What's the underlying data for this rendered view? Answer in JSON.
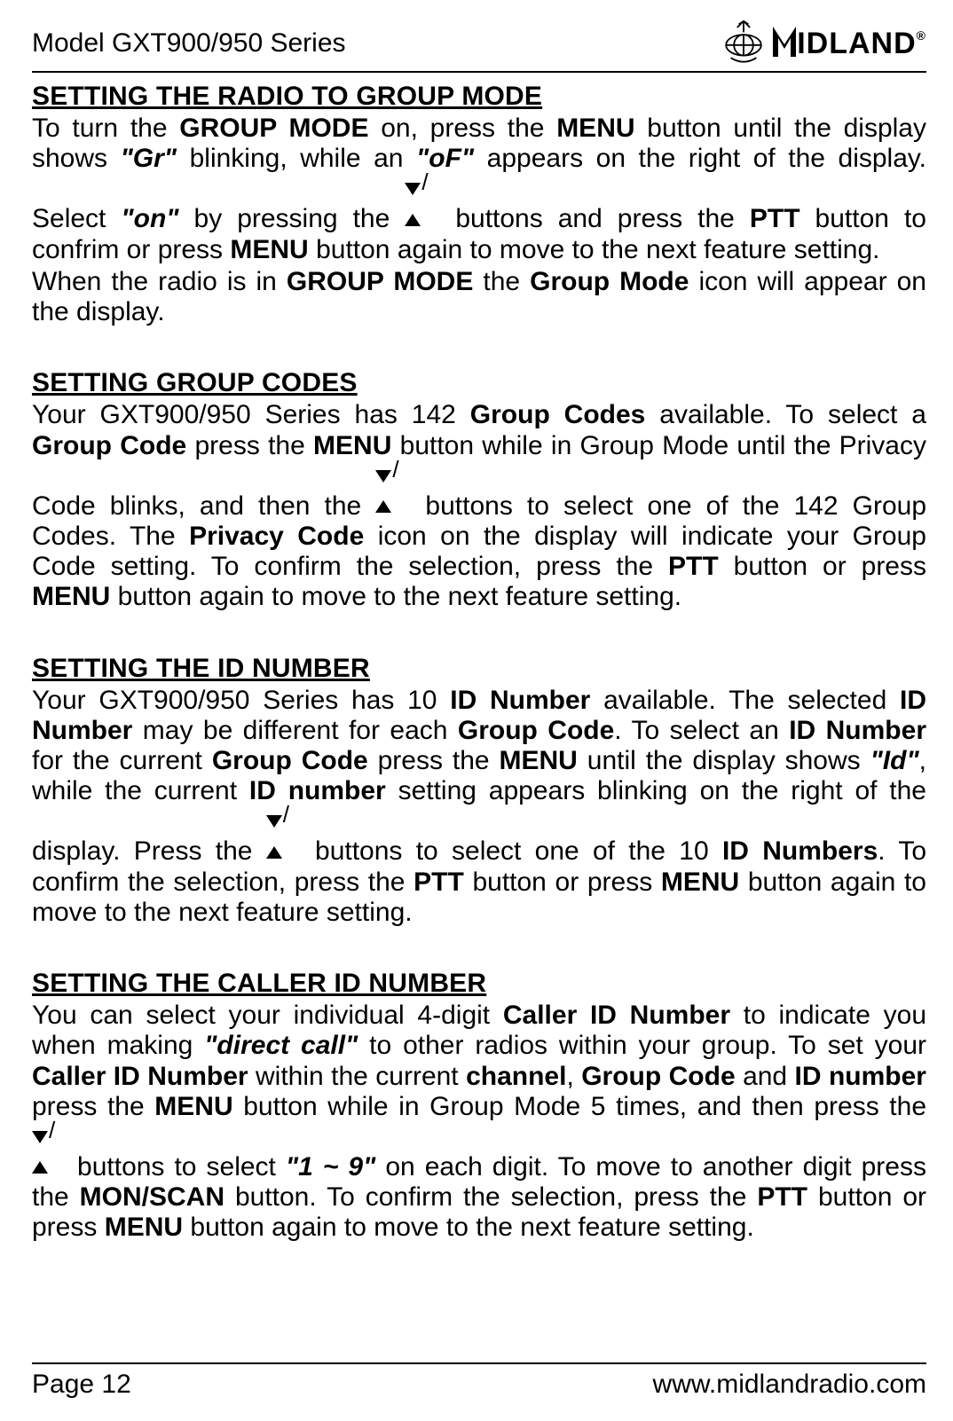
{
  "chart_data": null,
  "header": {
    "model": "Model GXT900/950 Series",
    "brand_letter": "M",
    "brand_rest": "IDLAND",
    "reg": "®"
  },
  "sections": {
    "s1": {
      "heading": "SETTING THE RADIO TO GROUP MODE",
      "p1a": "To turn the ",
      "p1b": "GROUP MODE",
      "p1c": " on, press the ",
      "p1d": "MENU",
      "p1e": " button until the display shows ",
      "p1f": "\"Gr\"",
      "p1g": " blinking, while an ",
      "p1h": "\"oF\"",
      "p1i": " appears on the right of the display. Select ",
      "p1j": "\"on\"",
      "p1k": " by pressing the ",
      "p1l": " buttons and press the ",
      "p1m": "PTT",
      "p1n": " button to confrim or press ",
      "p1o": "MENU",
      "p1p": " button again to move to the next feature setting.",
      "p2a": "When the radio is in ",
      "p2b": "GROUP MODE",
      "p2c": " the ",
      "p2d": "Group Mode",
      "p2e": " icon will appear on the display."
    },
    "s2": {
      "heading": "SETTING GROUP CODES",
      "p1a": "Your GXT900/950 Series has 142 ",
      "p1b": "Group Codes",
      "p1c": " available. To select a ",
      "p1d": "Group Code",
      "p1e": " press the ",
      "p1f": "MENU",
      "p1g": " button while in Group Mode until the Privacy Code blinks, and then the ",
      "p1h": " buttons to select one of the 142 Group Codes. The ",
      "p1i": "Privacy Code",
      "p1j": " icon on the display will indicate your Group Code setting. To confirm the selection, press the ",
      "p1k": "PTT",
      "p1l": " button or press ",
      "p1m": "MENU",
      "p1n": " button again to move to the next feature setting."
    },
    "s3": {
      "heading": "SETTING THE ID NUMBER",
      "p1a": "Your GXT900/950 Series has 10 ",
      "p1b": "ID Number",
      "p1c": " available. The selected ",
      "p1d": "ID Number",
      "p1e": " may be different for each ",
      "p1f": "Group Code",
      "p1g": ". To select an ",
      "p1h": "ID Number",
      "p1i": " for the current ",
      "p1j": "Group Code",
      "p1k": " press the ",
      "p1l": "MENU",
      "p1m": " until the display shows ",
      "p1n": "\"Id\"",
      "p1o": ", while the current ",
      "p1p": "ID number",
      "p1q": " setting appears blinking on the right of the display. Press the ",
      "p1r": " buttons to select one of the 10 ",
      "p1s": "ID Numbers",
      "p1t": ". To confirm the selection, press the ",
      "p1u": "PTT",
      "p1v": " button or press ",
      "p1w": "MENU",
      "p1x": " button again to move to the next feature setting."
    },
    "s4": {
      "heading": "SETTING THE CALLER ID NUMBER",
      "p1a": "You can select your individual 4-digit ",
      "p1b": "Caller ID Number",
      "p1c": " to indicate you when making ",
      "p1d": "\"direct call\"",
      "p1e": " to other radios within your group. To set your ",
      "p1f": "Caller ID Number",
      "p1g": " within the current ",
      "p1h": "channel",
      "p1i": ", ",
      "p1j": "Group Code",
      "p1k": " and ",
      "p1l": "ID number",
      "p1m": " press the ",
      "p1n": "MENU",
      "p1o": " button while in Group Mode 5 times, and then press the ",
      "p1p": " buttons to select ",
      "p1q": "\"1 ~ 9\"",
      "p1r": " on each digit. To move to another digit press the ",
      "p1s": "MON/SCAN",
      "p1t": " button. To confirm the selection, press the ",
      "p1u": "PTT",
      "p1v": " button or press ",
      "p1w": "MENU",
      "p1x": " button again to move to the next feature setting."
    }
  },
  "footer": {
    "page": "Page 12",
    "url": "www.midlandradio.com"
  }
}
